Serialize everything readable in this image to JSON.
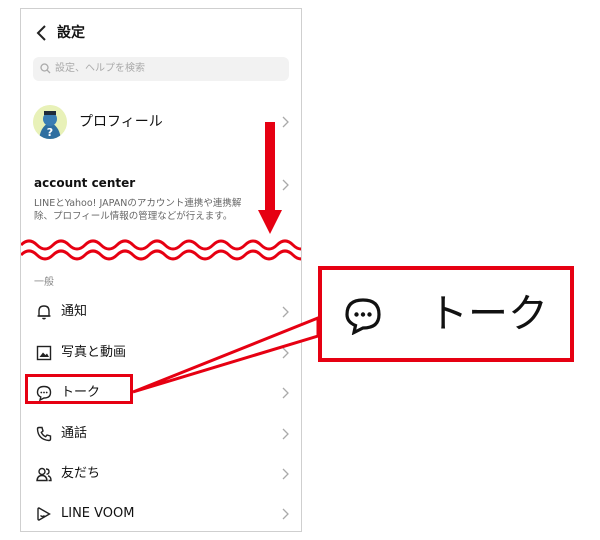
{
  "header": {
    "title": "設定"
  },
  "search": {
    "placeholder": "設定、ヘルプを検索"
  },
  "profile": {
    "label": "プロフィール"
  },
  "account_center": {
    "title": "account center",
    "desc_line1": "LINEとYahoo! JAPANのアカウント連携や連携解",
    "desc_line2": "除、プロフィール情報の管理などが行えます。"
  },
  "section_general": "一般",
  "menu": [
    {
      "label": "通知",
      "icon": "bell-icon"
    },
    {
      "label": "写真と動画",
      "icon": "photo-icon"
    },
    {
      "label": "トーク",
      "icon": "chat-bubble-icon"
    },
    {
      "label": "通話",
      "icon": "phone-icon"
    },
    {
      "label": "友だち",
      "icon": "friends-icon"
    },
    {
      "label": "LINE VOOM",
      "icon": "voom-icon"
    }
  ],
  "callout": {
    "label": "トーク",
    "icon": "chat-bubble-icon"
  },
  "colors": {
    "accent": "#e60012"
  }
}
